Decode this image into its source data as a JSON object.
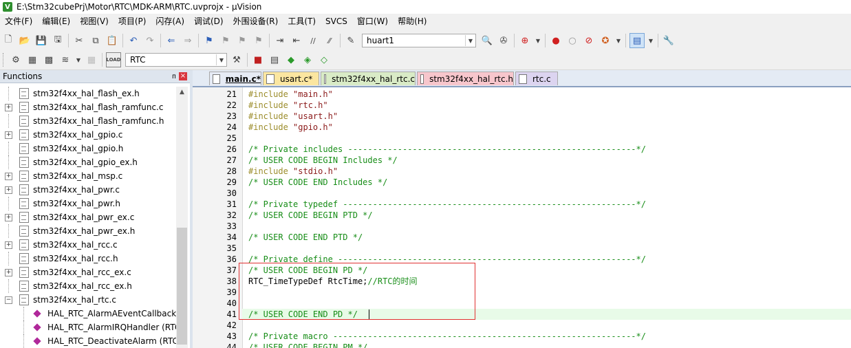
{
  "window": {
    "title": "E:\\Stm32cubePrj\\Motor\\RTC\\MDK-ARM\\RTC.uvprojx - µVision",
    "app_icon_letter": "V"
  },
  "menu": [
    "文件(F)",
    "编辑(E)",
    "视图(V)",
    "项目(P)",
    "闪存(A)",
    "调试(D)",
    "外围设备(R)",
    "工具(T)",
    "SVCS",
    "窗口(W)",
    "帮助(H)"
  ],
  "toolbar1": {
    "find_combo_value": "huart1",
    "icons": [
      "new-file-icon",
      "open-icon",
      "save-icon",
      "save-all-icon",
      "cut-icon",
      "copy-icon",
      "paste-icon",
      "undo-icon",
      "redo-icon",
      "nav-back-icon",
      "nav-forward-icon",
      "bookmark-icon",
      "bookmark-prev-icon",
      "bookmark-next-icon",
      "bookmark-clear-icon",
      "indent-icon",
      "unindent-icon",
      "comment-icon",
      "uncomment-icon",
      "find-in-files-icon",
      "find-icon",
      "incremental-find-icon",
      "debug-start-icon",
      "breakpoint-icon",
      "breakpoint-disable-icon",
      "breakpoint-kill-icon",
      "window-layout-icon",
      "configure-icon"
    ]
  },
  "toolbar2": {
    "target_combo_value": "RTC",
    "load_label": "LOAD"
  },
  "functions_panel": {
    "title": "Functions",
    "pin_glyph": "ᴨ",
    "close_glyph": "×",
    "items": [
      {
        "label": "stm32f4xx_hal_flash_ex.h",
        "expander": "",
        "kind": "file"
      },
      {
        "label": "stm32f4xx_hal_flash_ramfunc.c",
        "expander": "+",
        "kind": "file"
      },
      {
        "label": "stm32f4xx_hal_flash_ramfunc.h",
        "expander": "",
        "kind": "file"
      },
      {
        "label": "stm32f4xx_hal_gpio.c",
        "expander": "+",
        "kind": "file"
      },
      {
        "label": "stm32f4xx_hal_gpio.h",
        "expander": "",
        "kind": "file"
      },
      {
        "label": "stm32f4xx_hal_gpio_ex.h",
        "expander": "",
        "kind": "file"
      },
      {
        "label": "stm32f4xx_hal_msp.c",
        "expander": "+",
        "kind": "file"
      },
      {
        "label": "stm32f4xx_hal_pwr.c",
        "expander": "+",
        "kind": "file"
      },
      {
        "label": "stm32f4xx_hal_pwr.h",
        "expander": "",
        "kind": "file"
      },
      {
        "label": "stm32f4xx_hal_pwr_ex.c",
        "expander": "+",
        "kind": "file"
      },
      {
        "label": "stm32f4xx_hal_pwr_ex.h",
        "expander": "",
        "kind": "file"
      },
      {
        "label": "stm32f4xx_hal_rcc.c",
        "expander": "+",
        "kind": "file"
      },
      {
        "label": "stm32f4xx_hal_rcc.h",
        "expander": "",
        "kind": "file"
      },
      {
        "label": "stm32f4xx_hal_rcc_ex.c",
        "expander": "+",
        "kind": "file"
      },
      {
        "label": "stm32f4xx_hal_rcc_ex.h",
        "expander": "",
        "kind": "file"
      },
      {
        "label": "stm32f4xx_hal_rtc.c",
        "expander": "−",
        "kind": "file"
      },
      {
        "label": "HAL_RTC_AlarmAEventCallback (",
        "expander": "",
        "kind": "func"
      },
      {
        "label": "HAL_RTC_AlarmIRQHandler (RTC",
        "expander": "",
        "kind": "func"
      },
      {
        "label": "HAL_RTC_DeactivateAlarm (RTC_",
        "expander": "",
        "kind": "func"
      }
    ]
  },
  "tabs": [
    {
      "label": "main.c*",
      "color": "#e6ebf5",
      "active": true
    },
    {
      "label": "usart.c*",
      "color": "#fbe6a0",
      "active": false
    },
    {
      "label": "stm32f4xx_hal_rtc.c",
      "color": "#d9ebc6",
      "active": false
    },
    {
      "label": "stm32f4xx_hal_rtc.h",
      "color": "#f7c6cc",
      "active": false
    },
    {
      "label": "rtc.c",
      "color": "#dcd4f0",
      "active": false
    }
  ],
  "code": [
    {
      "n": "21",
      "parts": [
        [
          "inc",
          "#include "
        ],
        [
          "str",
          "\"main.h\""
        ]
      ]
    },
    {
      "n": "22",
      "parts": [
        [
          "inc",
          "#include "
        ],
        [
          "str",
          "\"rtc.h\""
        ]
      ]
    },
    {
      "n": "23",
      "parts": [
        [
          "inc",
          "#include "
        ],
        [
          "str",
          "\"usart.h\""
        ]
      ]
    },
    {
      "n": "24",
      "parts": [
        [
          "inc",
          "#include "
        ],
        [
          "str",
          "\"gpio.h\""
        ]
      ]
    },
    {
      "n": "25",
      "parts": []
    },
    {
      "n": "26",
      "parts": [
        [
          "cmt",
          "/* Private includes ----------------------------------------------------------*/"
        ]
      ]
    },
    {
      "n": "27",
      "parts": [
        [
          "cmt",
          "/* USER CODE BEGIN Includes */"
        ]
      ]
    },
    {
      "n": "28",
      "parts": [
        [
          "inc",
          "#include "
        ],
        [
          "str",
          "\"stdio.h\""
        ]
      ]
    },
    {
      "n": "29",
      "parts": [
        [
          "cmt",
          "/* USER CODE END Includes */"
        ]
      ]
    },
    {
      "n": "30",
      "parts": []
    },
    {
      "n": "31",
      "parts": [
        [
          "cmt",
          "/* Private typedef -----------------------------------------------------------*/"
        ]
      ]
    },
    {
      "n": "32",
      "parts": [
        [
          "cmt",
          "/* USER CODE BEGIN PTD */"
        ]
      ]
    },
    {
      "n": "33",
      "parts": []
    },
    {
      "n": "34",
      "parts": [
        [
          "cmt",
          "/* USER CODE END PTD */"
        ]
      ]
    },
    {
      "n": "35",
      "parts": []
    },
    {
      "n": "36",
      "parts": [
        [
          "cmt",
          "/* Private define ------------------------------------------------------------*/"
        ]
      ]
    },
    {
      "n": "37",
      "parts": [
        [
          "cmt",
          "/* USER CODE BEGIN PD */"
        ]
      ]
    },
    {
      "n": "38",
      "parts": [
        [
          "plain",
          "RTC_TimeTypeDef RtcTime;"
        ],
        [
          "cmt",
          "//RTC的时间"
        ]
      ]
    },
    {
      "n": "39",
      "parts": []
    },
    {
      "n": "40",
      "parts": []
    },
    {
      "n": "41",
      "parts": [
        [
          "cmt",
          "/* USER CODE END PD */"
        ]
      ],
      "highlight": true
    },
    {
      "n": "42",
      "parts": []
    },
    {
      "n": "43",
      "parts": [
        [
          "cmt",
          "/* Private macro -------------------------------------------------------------*/"
        ]
      ]
    },
    {
      "n": "44",
      "parts": [
        [
          "cmt",
          "/* USER CODE BEGIN PM */"
        ]
      ]
    }
  ]
}
